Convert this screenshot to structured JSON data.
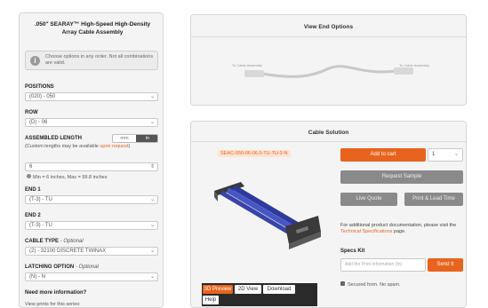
{
  "sidebar": {
    "title": ".050\" SEARAY™ High-Speed High-Density Array Cable Assembly",
    "info_text": "Choose options in any order. Not all combinations are valid.",
    "positions": {
      "label": "POSITIONS",
      "value": "(020) - 050"
    },
    "row": {
      "label": "ROW",
      "value": "(D) - 06"
    },
    "assembled_length": {
      "label": "ASSEMBLED LENGTH",
      "unit_a": "mm",
      "unit_b": "in",
      "note_prefix": "(Custom lengths may be available ",
      "note_link": "upon request",
      "note_suffix": ")",
      "value": "6",
      "range": "Min = 6 inches, Max = 99.8 inches"
    },
    "end1": {
      "label": "END 1",
      "value": "(T-3) - TU"
    },
    "end2": {
      "label": "END 2",
      "value": "(T-3) - TU"
    },
    "cable_type": {
      "label": "CABLE TYPE",
      "optional": "- Optional",
      "value": "(2) - 32100 DISCRETE TWINAX"
    },
    "latching": {
      "label": "LATCHING OPTION",
      "optional": "- Optional",
      "value": "(N) - N"
    },
    "need_info": "Need more information?",
    "view_prints": "View prints for this series:"
  },
  "end_options": {
    "title": "View End Options",
    "end_label_left": "To Cable Assembly",
    "end_label_right": "To Cable Assembly"
  },
  "solution": {
    "title": "Cable Solution",
    "part_number": "SEAC-050-06-06.0-TU-TU-2-N",
    "add_to_cart": "Add to cart",
    "qty": "1",
    "request_sample": "Request Sample",
    "live_quote": "Live Quote",
    "print_lead_time": "Print & Lead Time",
    "doc_text_a": "For additional product documentation, please visit the ",
    "doc_link": "Technical Specifications",
    "doc_text_b": " page.",
    "specs_kit_label": "Specs Kit",
    "specs_kit_placeholder": "Add the Print Information (In)",
    "specs_kit_button": "Send It",
    "secure_text": "Secured form. No spam.",
    "view_tabs": [
      "3D Preview",
      "2D View",
      "Download",
      "Help"
    ]
  },
  "colors": {
    "accent": "#e8641e",
    "cable": "#3f4bb0"
  }
}
